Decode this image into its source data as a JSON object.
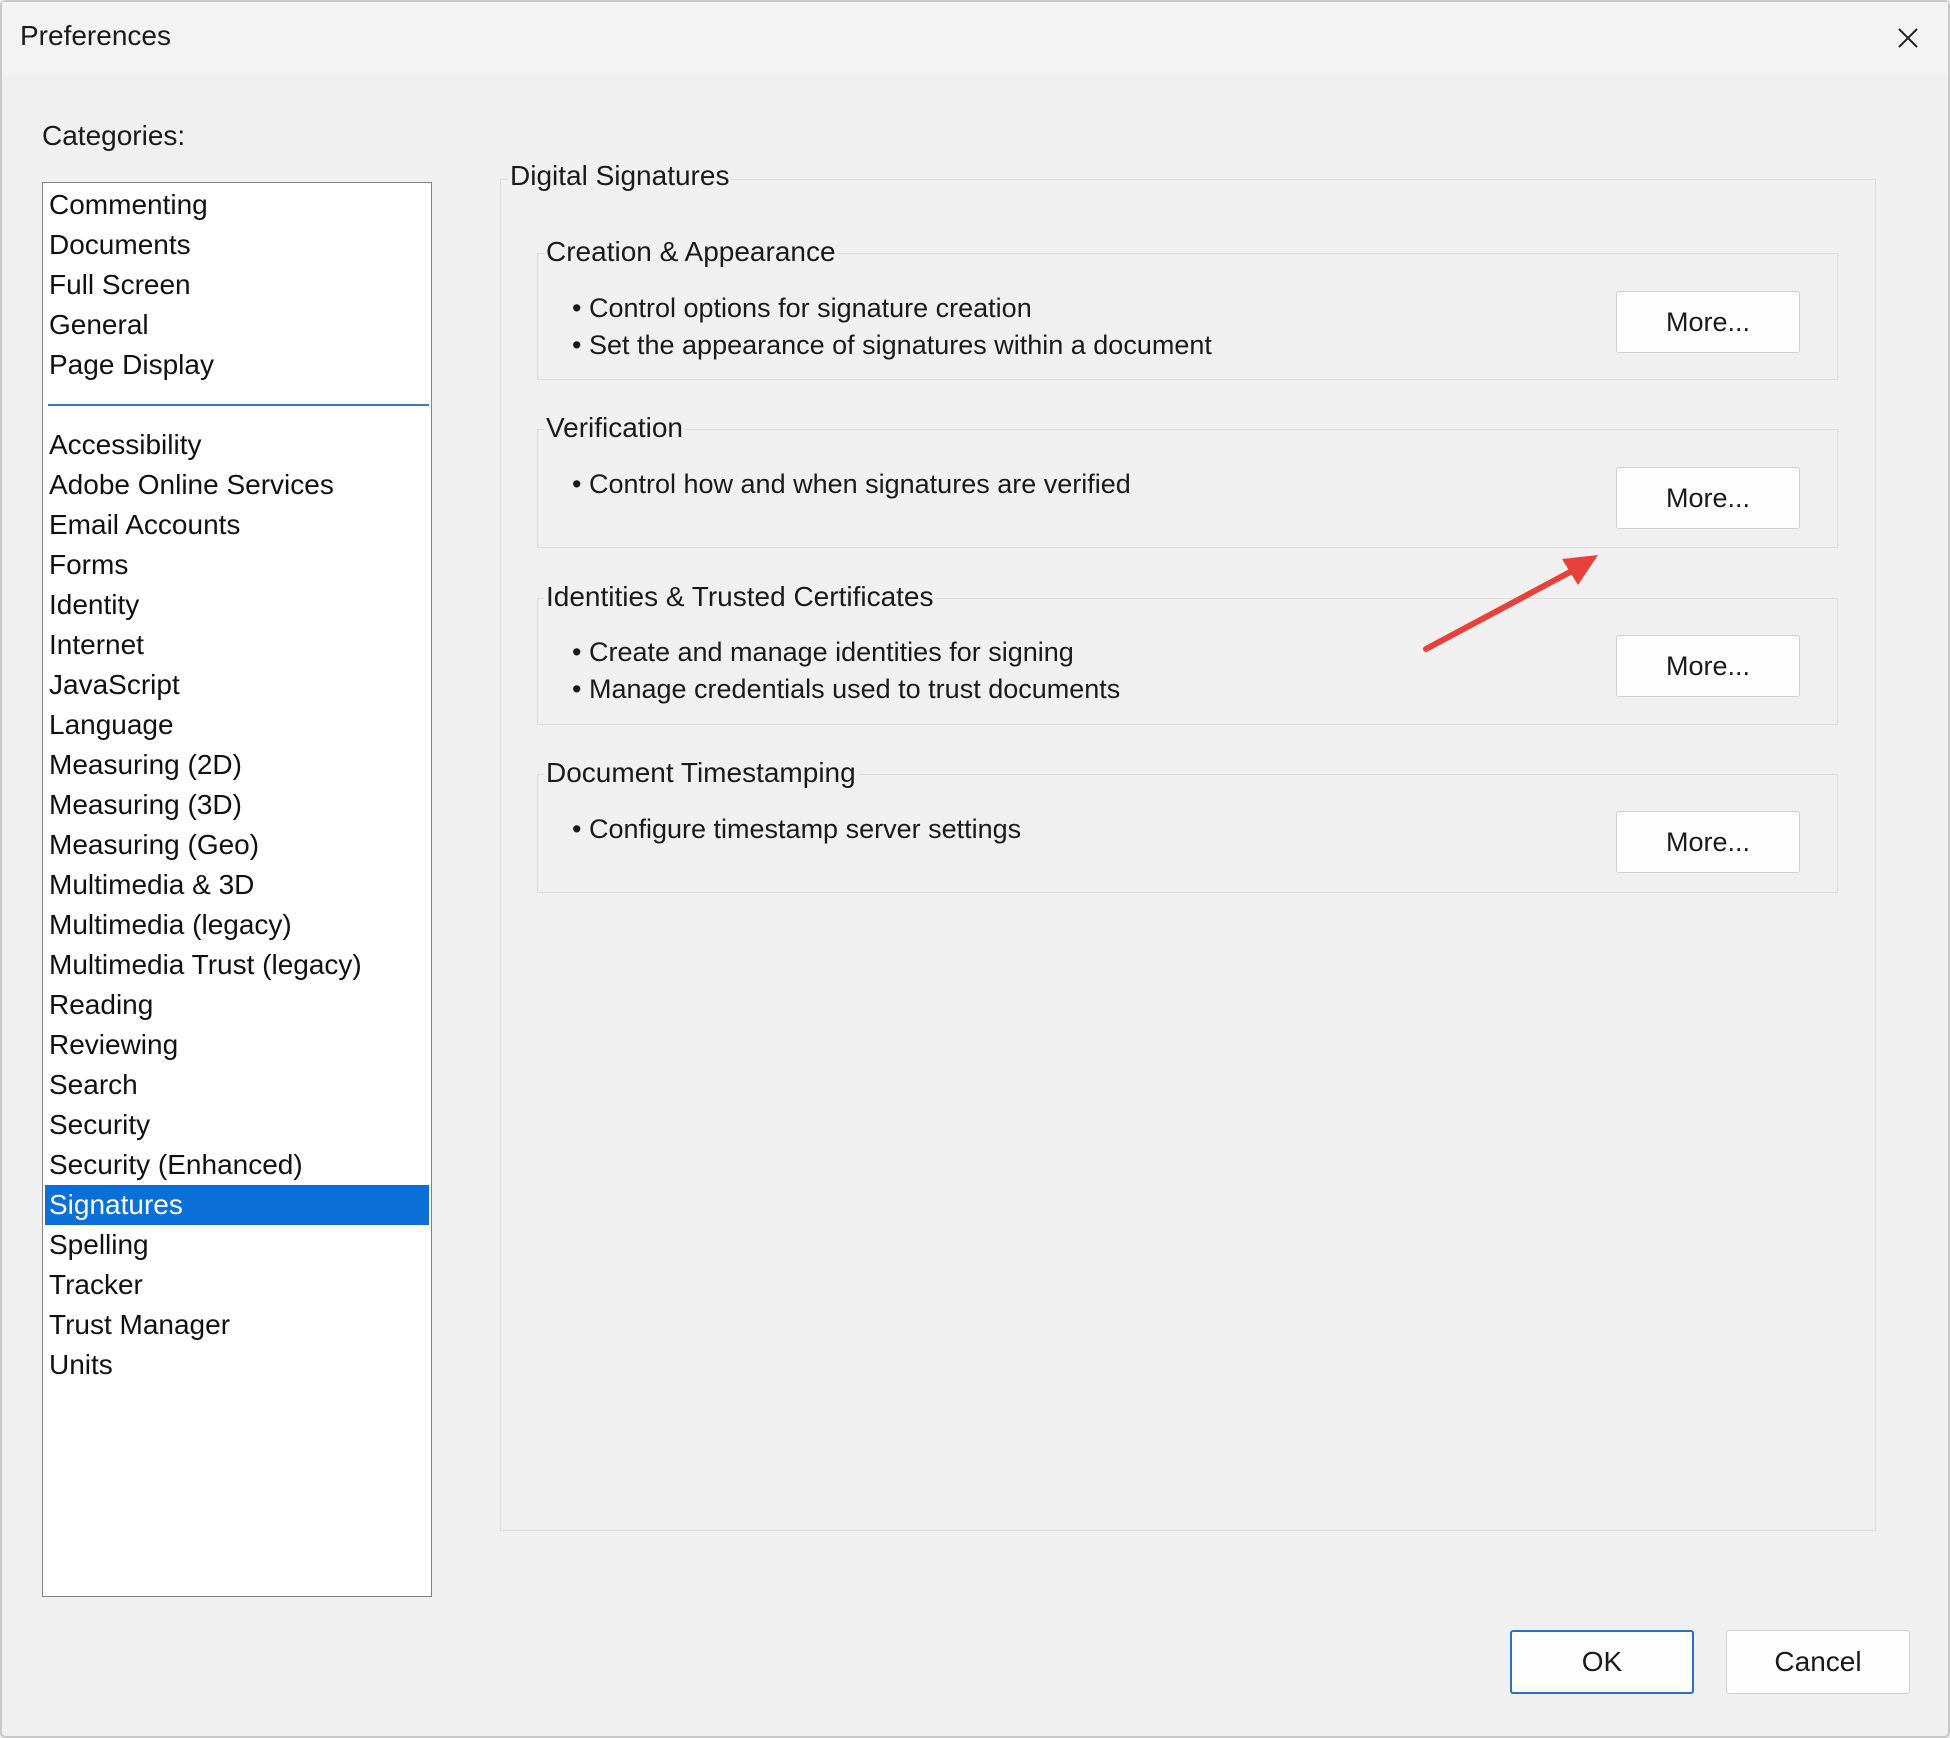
{
  "window": {
    "title": "Preferences"
  },
  "categories": {
    "label": "Categories:",
    "top_items": [
      "Commenting",
      "Documents",
      "Full Screen",
      "General",
      "Page Display"
    ],
    "items": [
      "Accessibility",
      "Adobe Online Services",
      "Email Accounts",
      "Forms",
      "Identity",
      "Internet",
      "JavaScript",
      "Language",
      "Measuring (2D)",
      "Measuring (3D)",
      "Measuring (Geo)",
      "Multimedia & 3D",
      "Multimedia (legacy)",
      "Multimedia Trust (legacy)",
      "Reading",
      "Reviewing",
      "Search",
      "Security",
      "Security (Enhanced)",
      "Signatures",
      "Spelling",
      "Tracker",
      "Trust Manager",
      "Units"
    ],
    "selected": "Signatures"
  },
  "panel": {
    "title": "Digital Signatures",
    "groups": [
      {
        "title": "Creation & Appearance",
        "bullets": [
          "Control options for signature creation",
          "Set the appearance of signatures within a document"
        ],
        "button": "More..."
      },
      {
        "title": "Verification",
        "bullets": [
          "Control how and when signatures are verified"
        ],
        "button": "More..."
      },
      {
        "title": "Identities & Trusted Certificates",
        "bullets": [
          "Create and manage identities for signing",
          "Manage credentials used to trust documents"
        ],
        "button": "More..."
      },
      {
        "title": "Document Timestamping",
        "bullets": [
          "Configure timestamp server settings"
        ],
        "button": "More..."
      }
    ]
  },
  "buttons": {
    "ok": "OK",
    "cancel": "Cancel"
  },
  "colors": {
    "selection": "#0a6fd6",
    "ok_border": "#2a6fc9",
    "annotation_arrow": "#e8403a"
  }
}
